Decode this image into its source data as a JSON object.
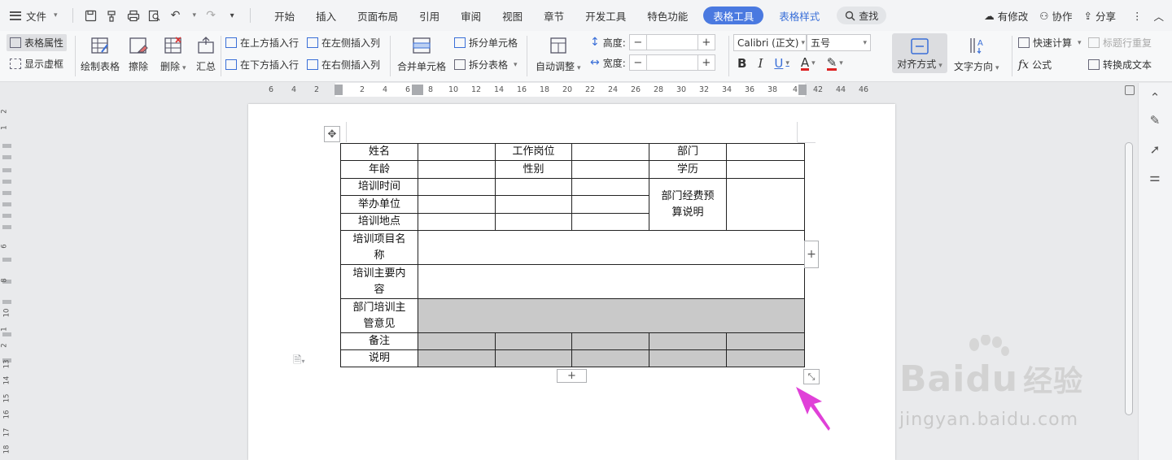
{
  "menubar": {
    "file_label": "文件",
    "tabs": [
      {
        "label": "开始"
      },
      {
        "label": "插入"
      },
      {
        "label": "页面布局"
      },
      {
        "label": "引用"
      },
      {
        "label": "审阅"
      },
      {
        "label": "视图"
      },
      {
        "label": "章节"
      },
      {
        "label": "开发工具"
      },
      {
        "label": "特色功能"
      }
    ],
    "active_tab": "表格工具",
    "style_tab": "表格样式",
    "search_label": "查找",
    "right": {
      "modified": "有修改",
      "collab": "协作",
      "share": "分享"
    }
  },
  "ribbon": {
    "table_props": "表格属性",
    "show_gridlines": "显示虚框",
    "draw_table": "绘制表格",
    "erase": "擦除",
    "delete": "删除",
    "summary": "汇总",
    "insert_above": "在上方插入行",
    "insert_below": "在下方插入行",
    "insert_left": "在左侧插入列",
    "insert_right": "在右侧插入列",
    "merge_cells": "合并单元格",
    "split_cells": "拆分单元格",
    "split_table": "拆分表格",
    "auto_fit": "自动调整",
    "height_label": "高度:",
    "width_label": "宽度:",
    "font_name": "Calibri (正文)",
    "font_size": "五号",
    "align": "对齐方式",
    "text_direction": "文字方向",
    "quick_calc": "快速计算",
    "repeat_header": "标题行重复",
    "formula": "公式",
    "to_text": "转换成文本"
  },
  "ruler": {
    "h_ticks": [
      "6",
      "4",
      "2",
      "",
      "2",
      "4",
      "6",
      "8",
      "10",
      "12",
      "14",
      "16",
      "18",
      "20",
      "22",
      "24",
      "26",
      "28",
      "30",
      "32",
      "34",
      "36",
      "38",
      "4",
      "42",
      "44",
      "46"
    ],
    "v_ticks": [
      "2",
      "1",
      "",
      "",
      "",
      "6",
      "",
      "8",
      "10",
      "1",
      "2",
      "13",
      "14",
      "15",
      "16",
      "17",
      "18"
    ]
  },
  "table": {
    "r1": {
      "name": "姓名",
      "post": "工作岗位",
      "dept": "部门"
    },
    "r2": {
      "age": "年龄",
      "gender": "性别",
      "edu": "学历"
    },
    "r3": {
      "train_time": "培训时间",
      "budget": "部门经费预算说明"
    },
    "r4": {
      "organizer": "举办单位"
    },
    "r5": {
      "location": "培训地点"
    },
    "r6": {
      "project_name": "培训项目名称"
    },
    "r7": {
      "content": "培训主要内容"
    },
    "r8": {
      "supervisor": "部门培训主管意见"
    },
    "r9": {
      "remark": "备注"
    },
    "r10": {
      "note": "说明"
    }
  },
  "watermark": {
    "logo": "Bai",
    "logo2": "du",
    "logo_cn": "经验",
    "url": "jingyan.baidu.com"
  },
  "colors": {
    "accent": "#4a79e0",
    "arrow": "#e040d8",
    "gray_cell": "#c9c9c9"
  }
}
